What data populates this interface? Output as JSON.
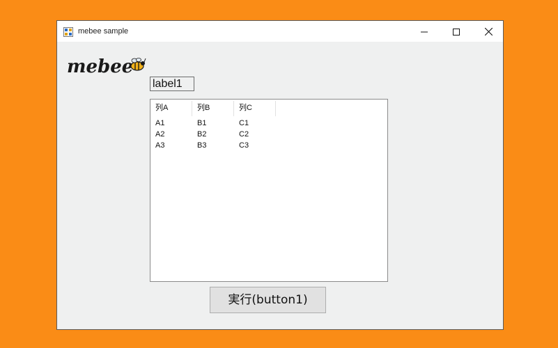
{
  "window": {
    "title": "mebee sample",
    "icon": "app-form-icon"
  },
  "controls": {
    "minimize_icon": "minimize-icon",
    "maximize_icon": "maximize-icon",
    "close_icon": "close-icon"
  },
  "logo": {
    "text": "mebee"
  },
  "label1": {
    "text": "label1"
  },
  "listview": {
    "columns": [
      "列A",
      "列B",
      "列C"
    ],
    "rows": [
      [
        "A1",
        "B1",
        "C1"
      ],
      [
        "A2",
        "B2",
        "C2"
      ],
      [
        "A3",
        "B3",
        "C3"
      ]
    ]
  },
  "button1": {
    "label": "実行(button1)"
  },
  "colors": {
    "desktop": "#fa8c16",
    "window_bg": "#eff0f0",
    "titlebar_bg": "#ffffff"
  }
}
